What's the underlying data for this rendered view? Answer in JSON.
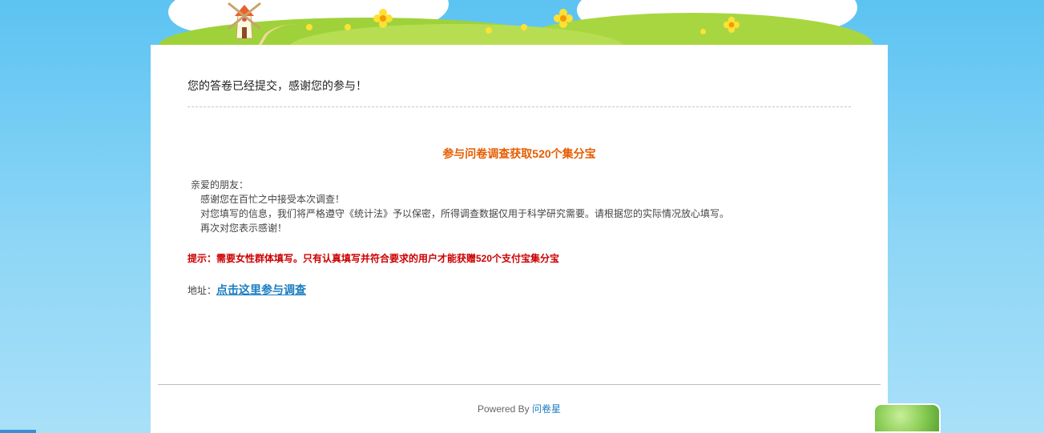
{
  "message": {
    "thanks": "您的答卷已经提交，感谢您的参与！"
  },
  "promo": {
    "title": "参与问卷调查获取520个集分宝",
    "greeting": "亲爱的朋友：",
    "lines": [
      "感谢您在百忙之中接受本次调查！",
      "对您填写的信息，我们将严格遵守《统计法》予以保密，所得调查数据仅用于科学研究需要。请根据您的实际情况放心填写。",
      "再次对您表示感谢！"
    ],
    "hint": "提示：需要女性群体填写。只有认真填写并符合要求的用户才能获赠520个支付宝集分宝",
    "address_label": "地址：",
    "address_link": "点击这里参与调查"
  },
  "footer": {
    "powered_by": "Powered By",
    "brand": "问卷星"
  },
  "colors": {
    "accent_orange": "#e65c00",
    "hint_red": "#cc0000",
    "link_blue": "#1a7dc0",
    "sky": "#5cc3f2"
  }
}
